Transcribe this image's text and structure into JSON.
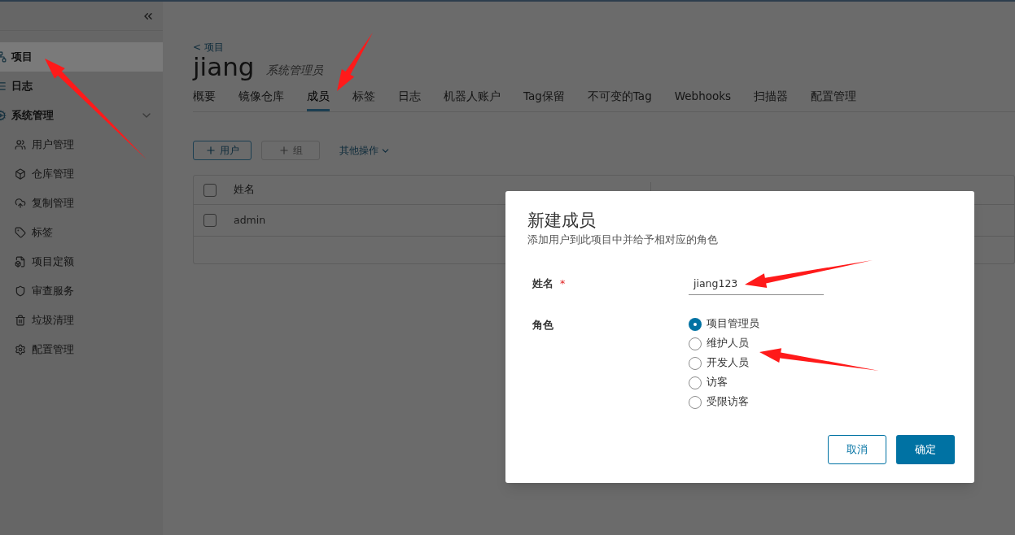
{
  "sidebar": {
    "items": [
      {
        "label": "项目",
        "selected": true
      },
      {
        "label": "日志",
        "selected": false
      },
      {
        "label": "系统管理",
        "selected": false,
        "expanded": true,
        "children": [
          {
            "label": "用户管理"
          },
          {
            "label": "仓库管理"
          },
          {
            "label": "复制管理"
          },
          {
            "label": "标签"
          },
          {
            "label": "项目定额"
          },
          {
            "label": "审查服务"
          },
          {
            "label": "垃圾清理"
          },
          {
            "label": "配置管理"
          }
        ]
      }
    ]
  },
  "breadcrumb": "< 项目",
  "project": {
    "name": "jiang",
    "role": "系统管理员"
  },
  "tabs": [
    {
      "label": "概要",
      "selected": false
    },
    {
      "label": "镜像仓库",
      "selected": false
    },
    {
      "label": "成员",
      "selected": true
    },
    {
      "label": "标签",
      "selected": false
    },
    {
      "label": "日志",
      "selected": false
    },
    {
      "label": "机器人账户",
      "selected": false
    },
    {
      "label": "Tag保留",
      "selected": false
    },
    {
      "label": "不可变的Tag",
      "selected": false
    },
    {
      "label": "Webhooks",
      "selected": false
    },
    {
      "label": "扫描器",
      "selected": false
    },
    {
      "label": "配置管理",
      "selected": false
    }
  ],
  "toolbar": [
    {
      "label": "用户",
      "disabled": false
    },
    {
      "label": "组",
      "disabled": true
    }
  ],
  "more_actions": "其他操作",
  "table": {
    "columns": [
      "姓名"
    ],
    "header_checked": false,
    "rows": [
      {
        "cells": [
          "admin"
        ],
        "checked": false
      }
    ]
  },
  "dialog": {
    "title": "新建成员",
    "subtitle": "添加用户到此项目中并给予相对应的角色",
    "name_label": "姓名",
    "required_mark": "*",
    "name_value": "jiang123",
    "role_label": "角色",
    "roles": [
      {
        "label": "项目管理员",
        "selected": true
      },
      {
        "label": "维护人员",
        "selected": false
      },
      {
        "label": "开发人员",
        "selected": false
      },
      {
        "label": "访客",
        "selected": false
      },
      {
        "label": "受限访客",
        "selected": false
      }
    ],
    "buttons": [
      {
        "label": "取消",
        "kind": "outline"
      },
      {
        "label": "确定",
        "kind": "primary"
      }
    ]
  }
}
